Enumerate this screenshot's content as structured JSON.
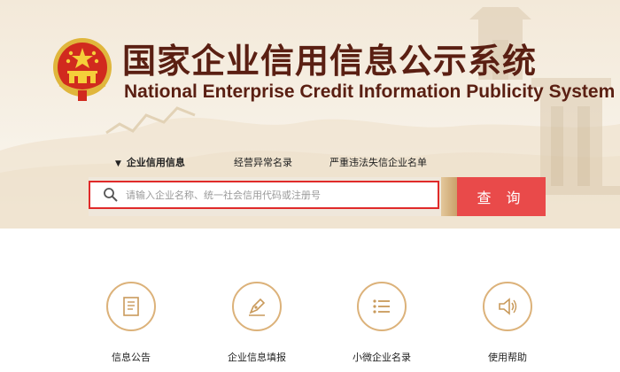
{
  "header": {
    "title_cn": "国家企业信用信息公示系统",
    "title_en": "National Enterprise Credit Information Publicity System",
    "emblem_icon": "national-emblem-icon"
  },
  "tabs": [
    {
      "label": "企业信用信息",
      "active": true
    },
    {
      "label": "经营异常名录",
      "active": false
    },
    {
      "label": "严重违法失信企业名单",
      "active": false
    }
  ],
  "search": {
    "placeholder": "请输入企业名称、统一社会信用代码或注册号",
    "value": "",
    "button_label": "查 询"
  },
  "services": [
    {
      "label": "信息公告",
      "icon": "document-icon"
    },
    {
      "label": "企业信息填报",
      "icon": "pen-icon"
    },
    {
      "label": "小微企业名录",
      "icon": "list-icon"
    },
    {
      "label": "使用帮助",
      "icon": "speaker-icon"
    }
  ],
  "colors": {
    "brand_dark": "#5a1f12",
    "accent_red": "#e94a4a",
    "gold": "#dcb27a",
    "highlight_border": "#e02a2a"
  }
}
